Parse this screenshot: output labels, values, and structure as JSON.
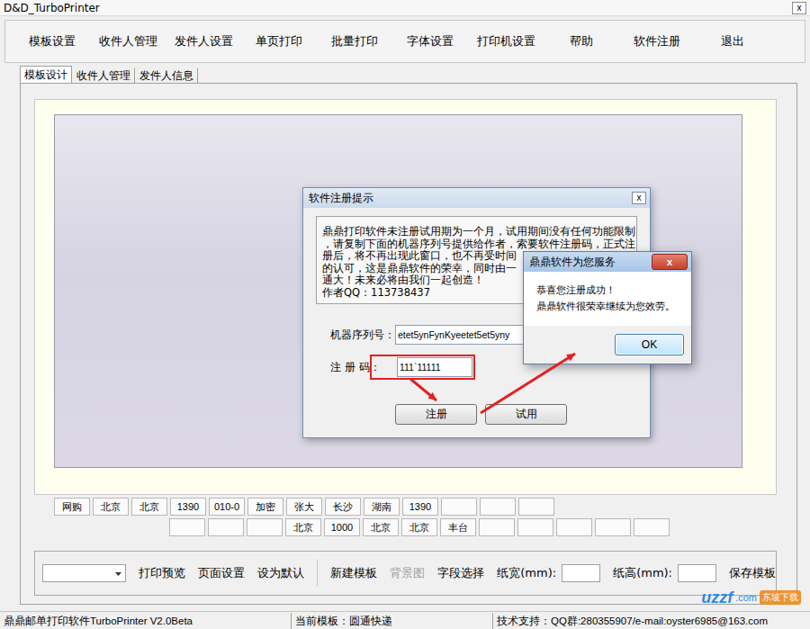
{
  "window": {
    "title": "D&D_TurboPrinter",
    "close": "x"
  },
  "toolbar": [
    "模板设置",
    "收件人管理",
    "发件人设置",
    "单页打印",
    "批量打印",
    "字体设置",
    "打印机设置",
    "帮助",
    "软件注册",
    "退出"
  ],
  "tabs": [
    {
      "label": "模板设计",
      "selected": true
    },
    {
      "label": "收件人管理",
      "selected": false
    },
    {
      "label": "发件人信息",
      "selected": false
    }
  ],
  "field_rows": [
    [
      "网购",
      "北京",
      "北京",
      "1390",
      "010-0",
      "加密",
      "张大",
      "长沙",
      "湖南",
      "1390",
      "",
      "",
      ""
    ],
    [
      "",
      "",
      "",
      "北京",
      "1000",
      "北京",
      "北京",
      "丰台",
      "",
      "",
      "",
      "",
      ""
    ]
  ],
  "dialog": {
    "title": "软件注册提示",
    "close": "x",
    "message_lines": [
      "鼎鼎打印软件未注册试用期为一个月，试用期间没有任何功能限制",
      "，请复制下面的机器序列号提供给作者，索要软件注册码，正式注",
      "册后，将不再出现此窗口，也不再受时间",
      "的认可，这是鼎鼎软件的荣幸，同时由一",
      "通大！未来必将由我们一起创造！",
      "作者QQ：113738437"
    ],
    "serial_label": "机器序列号：",
    "serial_value": "etet5ynFynKyeetet5et5yny",
    "code_label": "注 册 码：",
    "code_value": "111`11111",
    "buttons": [
      "注册",
      "试用"
    ]
  },
  "message_box": {
    "title": "鼎鼎软件为您服务",
    "close": "x",
    "lines": [
      "恭喜您注册成功！",
      "鼎鼎软件很荣幸继续为您效劳。"
    ],
    "button": "OK"
  },
  "bottom_bar": {
    "template_select": {
      "value": ""
    },
    "groups": [
      [
        {
          "label": "打印预览",
          "disabled": false
        },
        {
          "label": "页面设置",
          "disabled": false
        },
        {
          "label": "设为默认",
          "disabled": false
        }
      ],
      [
        {
          "label": "新建模板",
          "disabled": false
        },
        {
          "label": "背景图",
          "disabled": true
        },
        {
          "label": "字段选择",
          "disabled": false
        }
      ]
    ],
    "paper_width": {
      "label": "纸宽(mm):",
      "value": ""
    },
    "paper_height": {
      "label": "纸高(mm):",
      "value": ""
    },
    "save": {
      "label": "保存模板",
      "disabled": false
    }
  },
  "status_bar": [
    "鼎鼎邮单打印软件TurboPrinter V2.0Beta",
    "当前模板：圆通快递",
    "技术支持：QQ群:280355907/e-mail:oyster6985@163.com"
  ],
  "watermark": {
    "brand": "uzzf",
    "suffix": ".com",
    "tag": "东坡下载"
  }
}
